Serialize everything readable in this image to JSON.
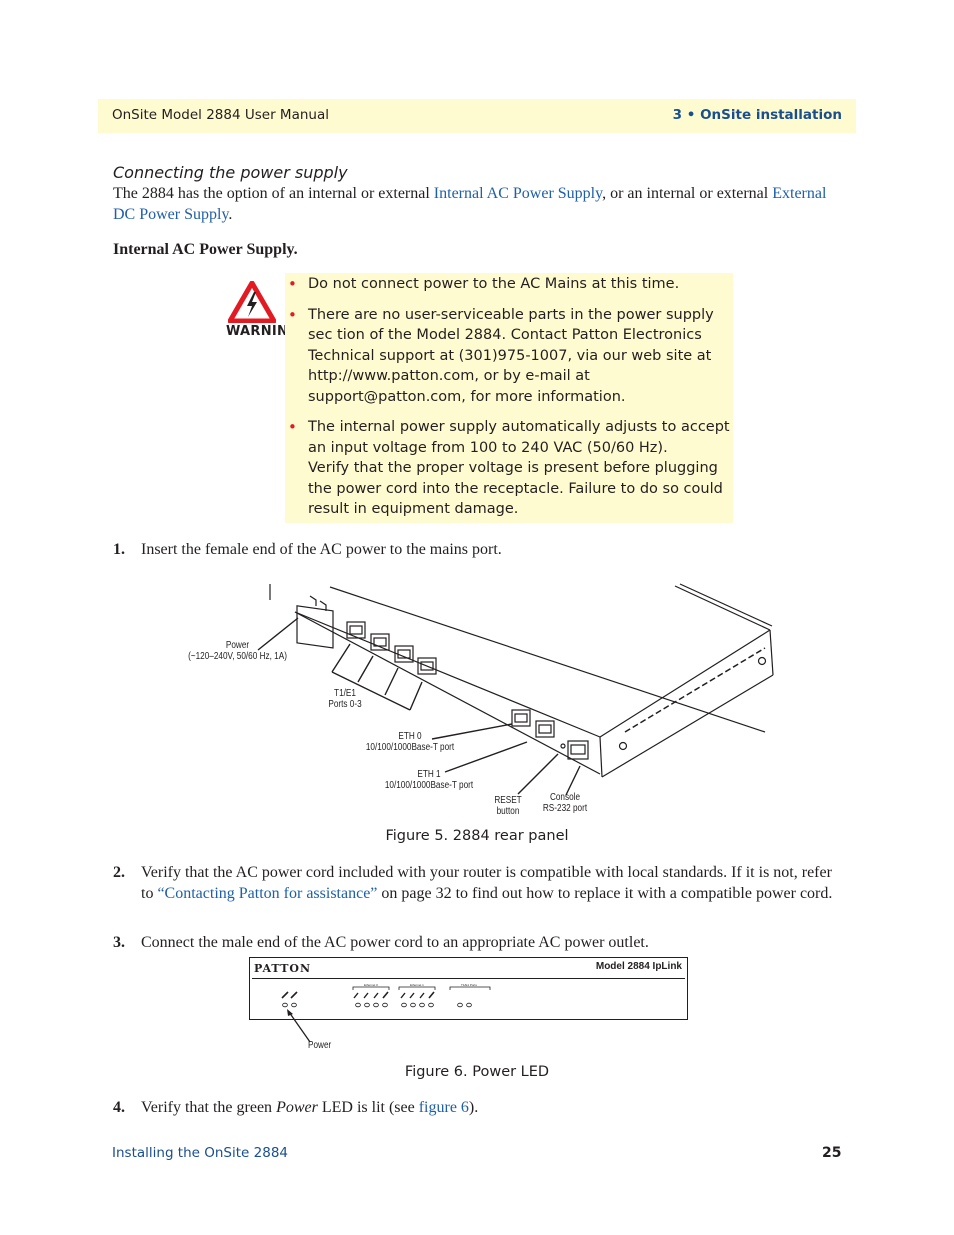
{
  "header": {
    "manual_title": "OnSite Model 2884 User Manual",
    "chapter": "3 • OnSite installation"
  },
  "section": {
    "title": "Connecting the power supply",
    "intro_before": "The 2884 has the option of an internal or external ",
    "intro_link1": "Internal AC Power Supply",
    "intro_middle": ", or an internal or external ",
    "intro_link2": "External DC Power Supply",
    "intro_after": "."
  },
  "subheading": "Internal AC Power Supply.",
  "warning": {
    "icon": "warning-electrical-hazard-icon",
    "label": "WARNING",
    "bullet_glyph": "•",
    "items": [
      "Do not connect power to the AC Mains at this time.",
      "There are no user-serviceable parts in the power supply sec tion of the Model 2884. Contact Patton Electronics Technical support at (301)975-1007, via our web site at http://www.patton.com, or by e-mail at support@patton.com, for more information.",
      "The internal power supply automatically adjusts to accept an input voltage from 100 to 240 VAC (50/60 Hz).",
      "Verify that the proper voltage is present before plugging the power cord into the receptacle. Failure to do so could result in equipment damage."
    ]
  },
  "steps": [
    {
      "num": "1.",
      "text": "Insert the female end of the AC power to the mains port."
    },
    {
      "num": "2.",
      "before": "Verify that the AC power cord included with your router is compatible with local standards. If it is not, refer to ",
      "link": "“Contacting Patton for assistance”",
      "after": " on page 32 to find out how to replace it with a compatible power cord."
    },
    {
      "num": "3.",
      "text": "Connect the male end of the AC power cord to an appropriate AC power outlet."
    },
    {
      "num": "4.",
      "before": "Verify that the green ",
      "italic": "Power",
      "middle": " LED is lit (see ",
      "link": "figure 6",
      "after": ")."
    }
  ],
  "figure5": {
    "caption": "Figure 5. 2884 rear panel",
    "callouts": {
      "power_line1": "Power",
      "power_line2": "(~120–240V, 50/60 Hz, 1A)",
      "t1e1_line1": "T1/E1",
      "t1e1_line2": "Ports 0-3",
      "eth0_line1": "ETH 0",
      "eth0_line2": "10/100/1000Base-T port",
      "eth1_line1": "ETH 1",
      "eth1_line2": "10/100/1000Base-T port",
      "reset_line1": "RESET",
      "reset_line2": "button",
      "console_line1": "Console",
      "console_line2": "RS-232 port"
    }
  },
  "figure6": {
    "caption": "Figure 6. Power LED",
    "brand": "PATTON",
    "model": "Model 2884 IpLink",
    "group_labels": [
      "Ethernet 0",
      "Ethernet 1",
      "T1/E1 Ports"
    ],
    "power_callout": "Power"
  },
  "footer": {
    "section_name": "Installing the OnSite 2884",
    "page_number": "25"
  }
}
